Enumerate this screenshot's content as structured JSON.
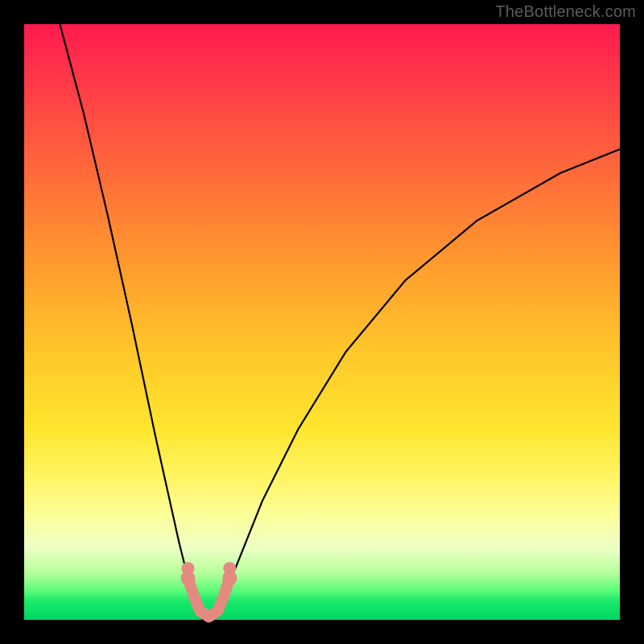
{
  "watermark": "TheBottleneck.com",
  "chart_data": {
    "type": "line",
    "title": "",
    "xlabel": "",
    "ylabel": "",
    "xlim": [
      0,
      100
    ],
    "ylim": [
      0,
      100
    ],
    "background_gradient": {
      "top": "#ff1a4f",
      "mid_upper": "#ff9a2e",
      "mid_lower": "#ffe62e",
      "bottom": "#00d760"
    },
    "series": [
      {
        "name": "bottleneck-curve",
        "x": [
          6,
          10,
          14,
          18,
          22,
          24,
          26,
          27,
          28,
          29,
          30,
          31,
          32,
          33,
          34,
          36,
          40,
          46,
          54,
          64,
          76,
          90,
          100
        ],
        "values": [
          100,
          85,
          68,
          50,
          31,
          22,
          13,
          9,
          5,
          2,
          0,
          0,
          1,
          3,
          5,
          10,
          20,
          32,
          45,
          57,
          67,
          75,
          79
        ]
      }
    ],
    "highlight_region": {
      "name": "sweet-spot",
      "points_x": [
        27.5,
        28.5,
        29.5,
        31,
        32.5,
        33.5,
        34.5
      ],
      "points_y": [
        7,
        4,
        1.5,
        0.5,
        1.5,
        4,
        7
      ]
    }
  }
}
